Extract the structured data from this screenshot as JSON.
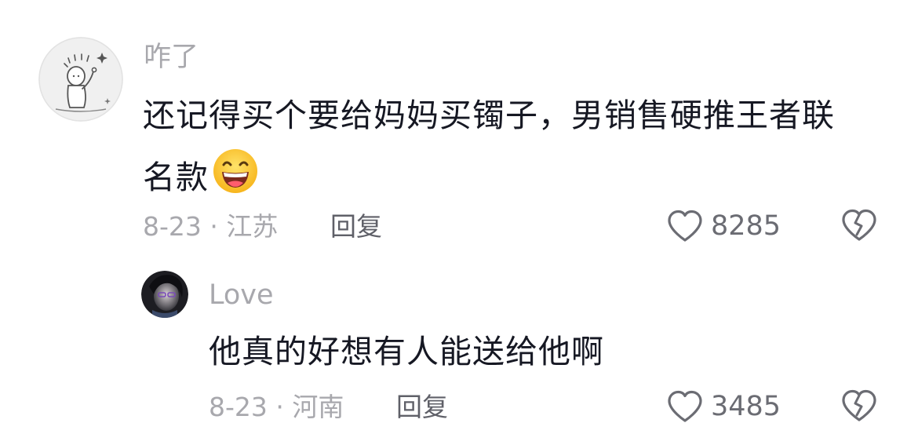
{
  "comments": [
    {
      "username": "咋了",
      "text_line1": "还记得买个要给妈妈买镯子，男销售硬推王者联",
      "text_line2": "名款",
      "emoji": "grinning-face",
      "meta": "8-23 · 江苏",
      "reply_label": "回复",
      "likes": "8285"
    },
    {
      "username": "Love",
      "text": "他真的好想有人能送给他啊",
      "meta": "8-23 · 河南",
      "reply_label": "回复",
      "likes": "3485"
    }
  ],
  "icons": {
    "like": "heart-outline-icon",
    "dislike": "broken-heart-icon"
  },
  "colors": {
    "text_primary": "#161823",
    "text_secondary": "#a8a8ad",
    "reply": "#5f6068",
    "icon": "#6b6c73"
  }
}
